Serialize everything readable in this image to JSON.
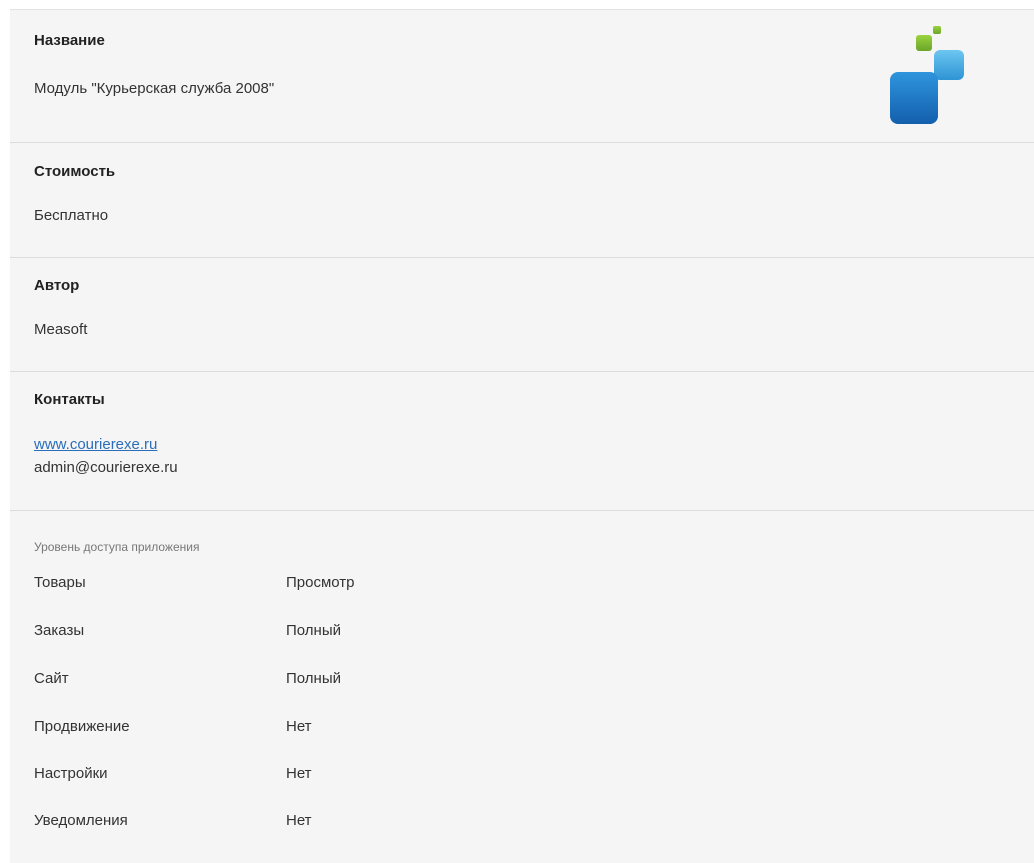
{
  "sections": {
    "name": {
      "title": "Название",
      "value": "Модуль \"Курьерская служба 2008\""
    },
    "cost": {
      "title": "Стоимость",
      "value": "Бесплатно"
    },
    "author": {
      "title": "Автор",
      "value": "Measoft"
    },
    "contacts": {
      "title": "Контакты",
      "website": "www.courierexe.ru",
      "email": "admin@courierexe.ru"
    }
  },
  "access": {
    "title": "Уровень доступа приложения",
    "rows": [
      {
        "name": "Товары",
        "level": "Просмотр"
      },
      {
        "name": "Заказы",
        "level": "Полный"
      },
      {
        "name": "Сайт",
        "level": "Полный"
      },
      {
        "name": "Продвижение",
        "level": "Нет"
      },
      {
        "name": "Настройки",
        "level": "Нет"
      },
      {
        "name": "Уведомления",
        "level": "Нет"
      }
    ]
  },
  "logo": {
    "icon": "app-logo-icon",
    "colors": {
      "green": "#7cb82f",
      "light_blue": "#3fa8dc",
      "blue": "#1b78c8"
    }
  }
}
